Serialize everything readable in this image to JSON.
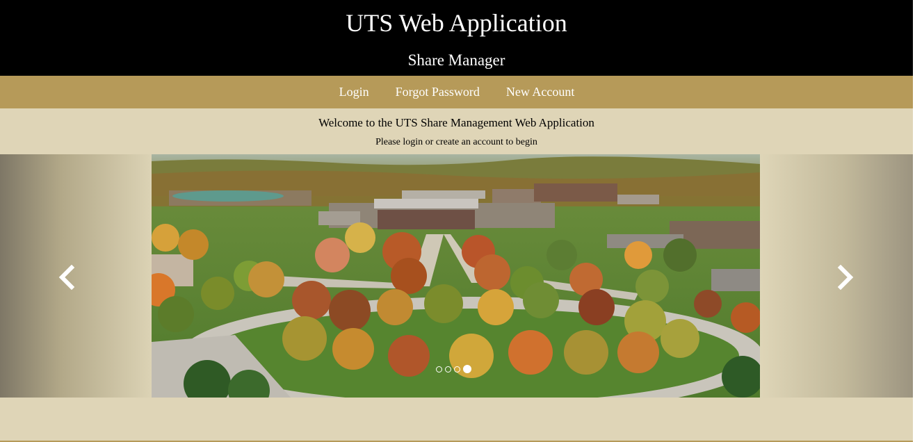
{
  "header": {
    "title": "UTS Web Application",
    "subtitle": "Share Manager"
  },
  "nav": {
    "items": [
      {
        "label": "Login"
      },
      {
        "label": "Forgot Password"
      },
      {
        "label": "New Account"
      }
    ]
  },
  "main": {
    "welcome": "Welcome to the UTS Share Management Web Application",
    "instructions": "Please login or create an account to begin"
  },
  "carousel": {
    "slide_count": 4,
    "active_index": 4,
    "prev_icon": "chevron-left-icon",
    "next_icon": "chevron-right-icon",
    "image": "aerial-campus-photo"
  },
  "colors": {
    "header_bg": "#000000",
    "nav_bg": "#b69a59",
    "content_bg": "#dfd5b7",
    "text_light": "#ffffff"
  }
}
